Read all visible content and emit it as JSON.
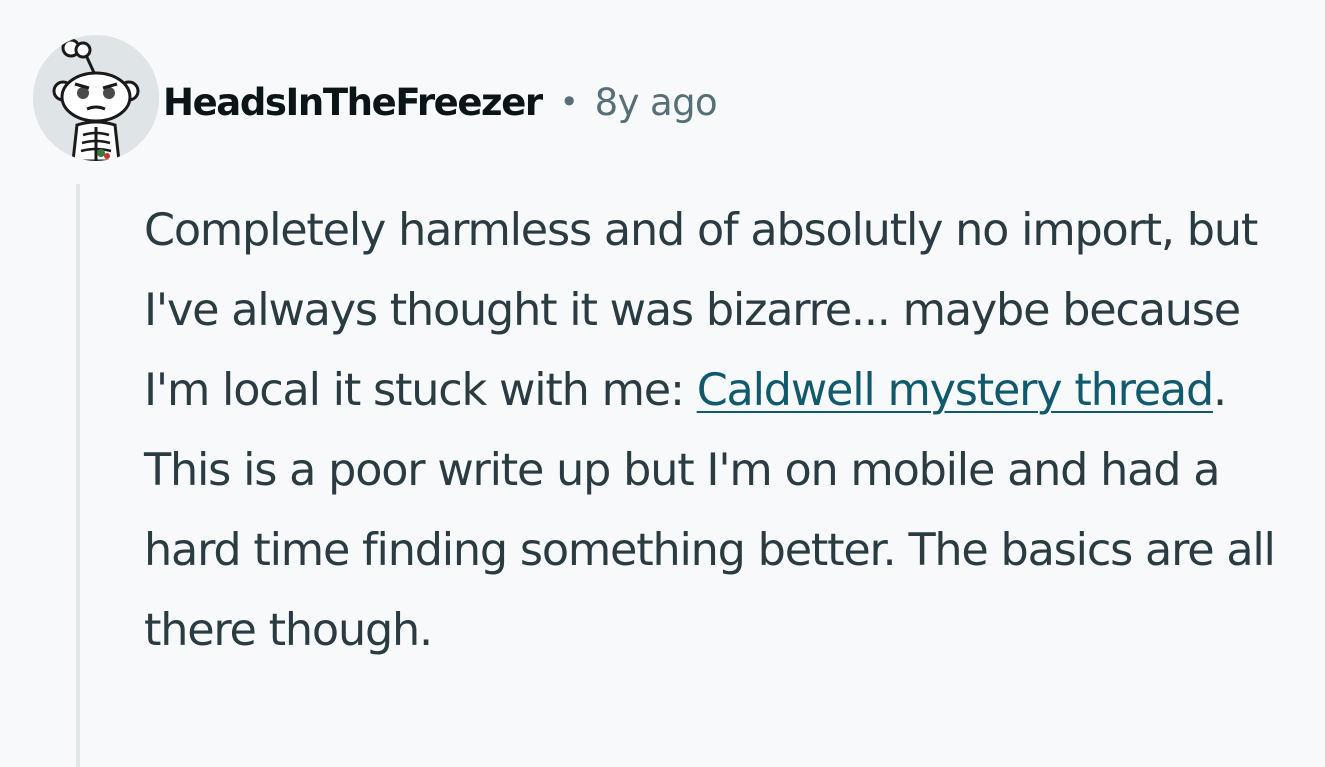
{
  "comment": {
    "author": "HeadsInTheFreezer",
    "separator": "•",
    "timestamp": "8y ago",
    "avatar_icon": "snoo-skeleton-avatar-icon",
    "body": {
      "before_link": "Completely harmless and of absolutly no import, but I've always thought it was bizarre... maybe because I'm local it stuck with me: ",
      "link_text": "Caldwell mystery thread",
      "after_link": ". This is a poor write up but I'm on mobile and had a hard time finding something better. The basics are all there though."
    }
  },
  "colors": {
    "background": "#f7f9fa",
    "author": "#0b1416",
    "meta": "#576f76",
    "body": "#2a3c42",
    "link": "#115a6e",
    "thread_line": "#e2e7e9"
  }
}
